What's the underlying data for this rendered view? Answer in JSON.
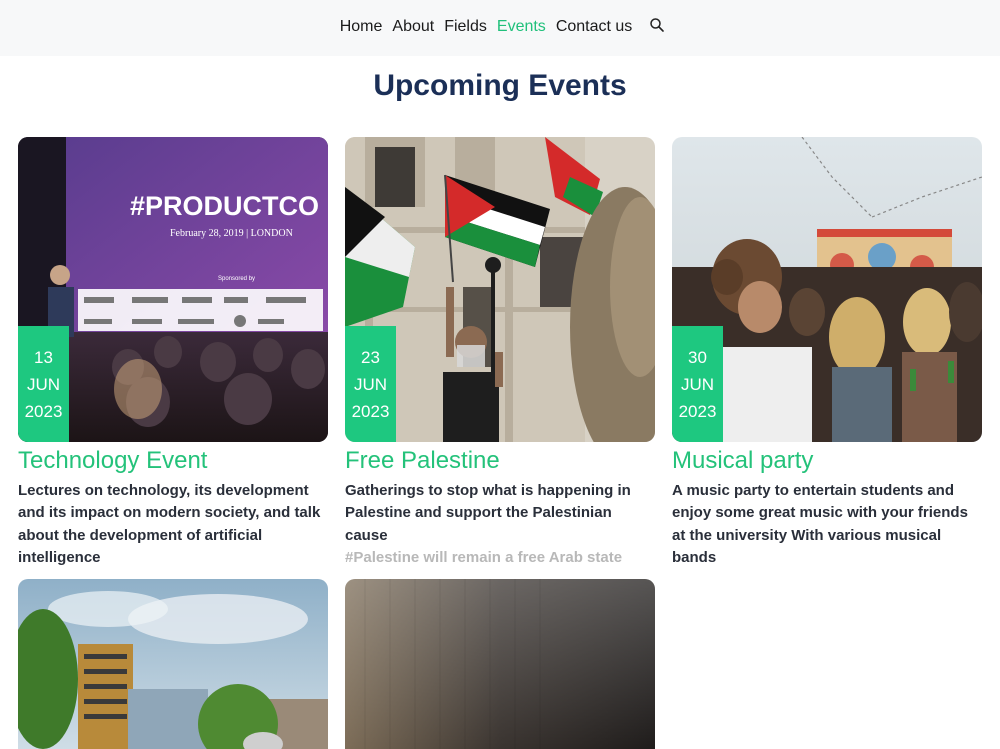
{
  "nav": {
    "items": [
      {
        "label": "Home"
      },
      {
        "label": "About"
      },
      {
        "label": "Fields"
      },
      {
        "label": "Events"
      },
      {
        "label": "Contact us"
      }
    ],
    "active": "Events",
    "search_icon": "search-icon"
  },
  "page": {
    "title": "Upcoming Events"
  },
  "events": [
    {
      "day": "13",
      "month": "JUN",
      "year": "2023",
      "title": "Technology Event",
      "description": "Lectures on technology, its development and its impact on modern society, and talk about the development of artificial intelligence",
      "image": {
        "slide_title": "#PRODUCTCO",
        "slide_subtitle": "February 28, 2019 | LONDON",
        "slide_sponsored": "Sponsored by"
      }
    },
    {
      "day": "23",
      "month": "JUN",
      "year": "2023",
      "title": "Free Palestine",
      "description": "Gatherings to stop what is happening in Palestine and support the Palestinian cause",
      "note": "#Palestine will remain a free Arab state"
    },
    {
      "day": "30",
      "month": "JUN",
      "year": "2023",
      "title": "Musical party",
      "description": "A music party to entertain students and enjoy some great music with your friends at the university With various musical bands"
    }
  ],
  "colors": {
    "accent": "#20c07b",
    "date_badge": "#1ec880",
    "title_navy": "#1b2f57",
    "nav_bg": "#f7f8f9"
  }
}
